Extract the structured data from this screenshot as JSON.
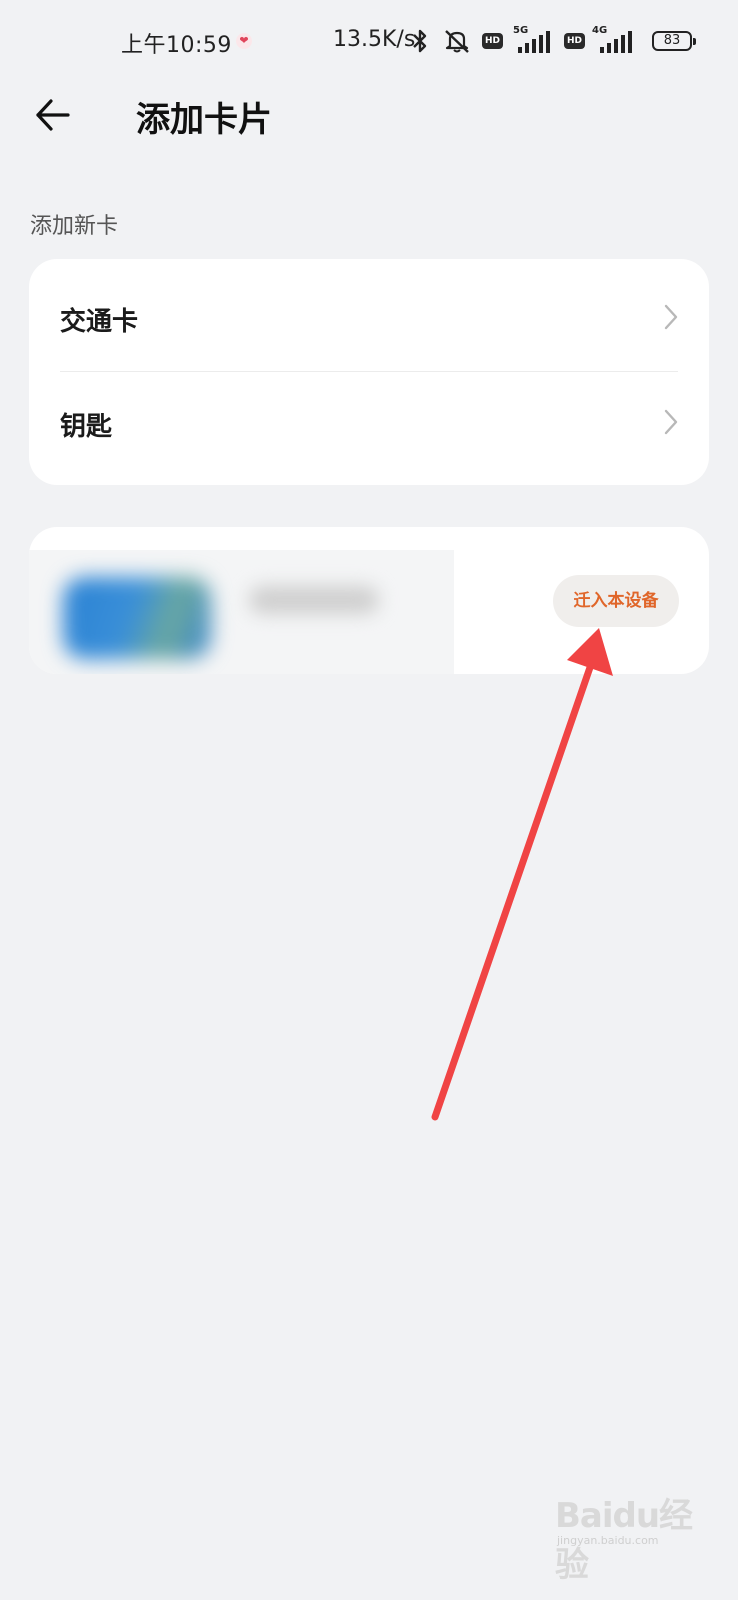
{
  "status_bar": {
    "time": "上午10:59",
    "net_speed": "13.5K/s",
    "hd_label": "HD",
    "network_1": "5G",
    "network_2": "4G",
    "battery": "83"
  },
  "header": {
    "title": "添加卡片"
  },
  "add_new_card": {
    "section_label": "添加新卡",
    "items": [
      {
        "label": "交通卡"
      },
      {
        "label": "钥匙"
      }
    ]
  },
  "existing_card": {
    "migrate_button": "迁入本设备"
  },
  "watermark": {
    "text": "Baidu经验",
    "sub": "jingyan.baidu.com"
  },
  "colors": {
    "background": "#f1f2f4",
    "card": "#ffffff",
    "accent_orange": "#e0662a",
    "annotation_arrow": "#f04444"
  },
  "icons": {
    "back": "arrow-left-icon",
    "chevron": "chevron-right-icon",
    "bluetooth": "bluetooth-icon",
    "mute": "bell-off-icon",
    "signal": "signal-bars-icon",
    "battery": "battery-icon",
    "health": "heart-icon"
  }
}
